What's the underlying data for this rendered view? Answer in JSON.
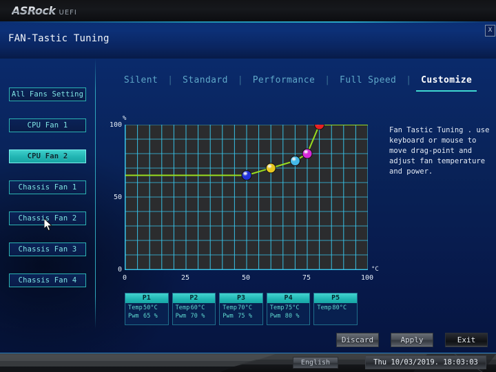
{
  "branding": {
    "logo": "ASRock",
    "suffix": "UEFI"
  },
  "header": {
    "title": "FAN-Tastic Tuning",
    "close_label": "X",
    "close_icon": "close-icon"
  },
  "sidebar": {
    "items": [
      {
        "label": "All Fans Setting",
        "selected": false
      },
      {
        "label": "CPU Fan 1",
        "selected": false
      },
      {
        "label": "CPU Fan 2",
        "selected": true
      },
      {
        "label": "Chassis Fan 1",
        "selected": false
      },
      {
        "label": "Chassis Fan 2",
        "selected": false
      },
      {
        "label": "Chassis Fan 3",
        "selected": false
      },
      {
        "label": "Chassis Fan 4",
        "selected": false
      }
    ]
  },
  "tabs": {
    "separator": "|",
    "items": [
      {
        "label": "Silent",
        "active": false
      },
      {
        "label": "Standard",
        "active": false
      },
      {
        "label": "Performance",
        "active": false
      },
      {
        "label": "Full Speed",
        "active": false
      },
      {
        "label": "Customize",
        "active": true
      }
    ]
  },
  "info": {
    "text": "Fan Tastic Tuning . use keyboard or mouse to move drag-point and adjust fan temperature and power."
  },
  "points": {
    "headers": [
      "P1",
      "P2",
      "P3",
      "P4",
      "P5"
    ],
    "temp_key": "Temp",
    "pwm_key": "Pwm",
    "items": [
      {
        "name": "P1",
        "temp": "50°C",
        "pwm": "65 %"
      },
      {
        "name": "P2",
        "temp": "60°C",
        "pwm": "70 %"
      },
      {
        "name": "P3",
        "temp": "70°C",
        "pwm": "75 %"
      },
      {
        "name": "P4",
        "temp": "75°C",
        "pwm": "80 %"
      },
      {
        "name": "P5",
        "temp": "80°C",
        "pwm": ""
      }
    ]
  },
  "actions": {
    "discard": "Discard",
    "apply": "Apply",
    "exit": "Exit"
  },
  "statusbar": {
    "language": "English",
    "datetime": "Thu 10/03/2019. 18:03:03"
  },
  "chart_data": {
    "type": "line",
    "title": "",
    "xlabel": "°C",
    "ylabel": "%",
    "xlim": [
      0,
      100
    ],
    "ylim": [
      0,
      100
    ],
    "xticks": [
      0,
      25,
      50,
      75,
      100
    ],
    "yticks": [
      0,
      50,
      100
    ],
    "grid": true,
    "grid_color": "#38c8ef",
    "plot_bg": "#2b2c2e",
    "line_color": "#9ade1e",
    "series": [
      {
        "name": "Fan Curve",
        "x": [
          0,
          50,
          60,
          70,
          75,
          80,
          100
        ],
        "y": [
          65,
          65,
          70,
          75,
          80,
          100,
          100
        ]
      }
    ],
    "markers": [
      {
        "label": "P1",
        "x": 50,
        "y": 65,
        "color": "#2233dd"
      },
      {
        "label": "P2",
        "x": 60,
        "y": 70,
        "color": "#e8c820"
      },
      {
        "label": "P3",
        "x": 70,
        "y": 75,
        "color": "#44b8e8"
      },
      {
        "label": "P4",
        "x": 75,
        "y": 80,
        "color": "#d828d8"
      },
      {
        "label": "P5",
        "x": 80,
        "y": 100,
        "color": "#e82020"
      }
    ]
  }
}
